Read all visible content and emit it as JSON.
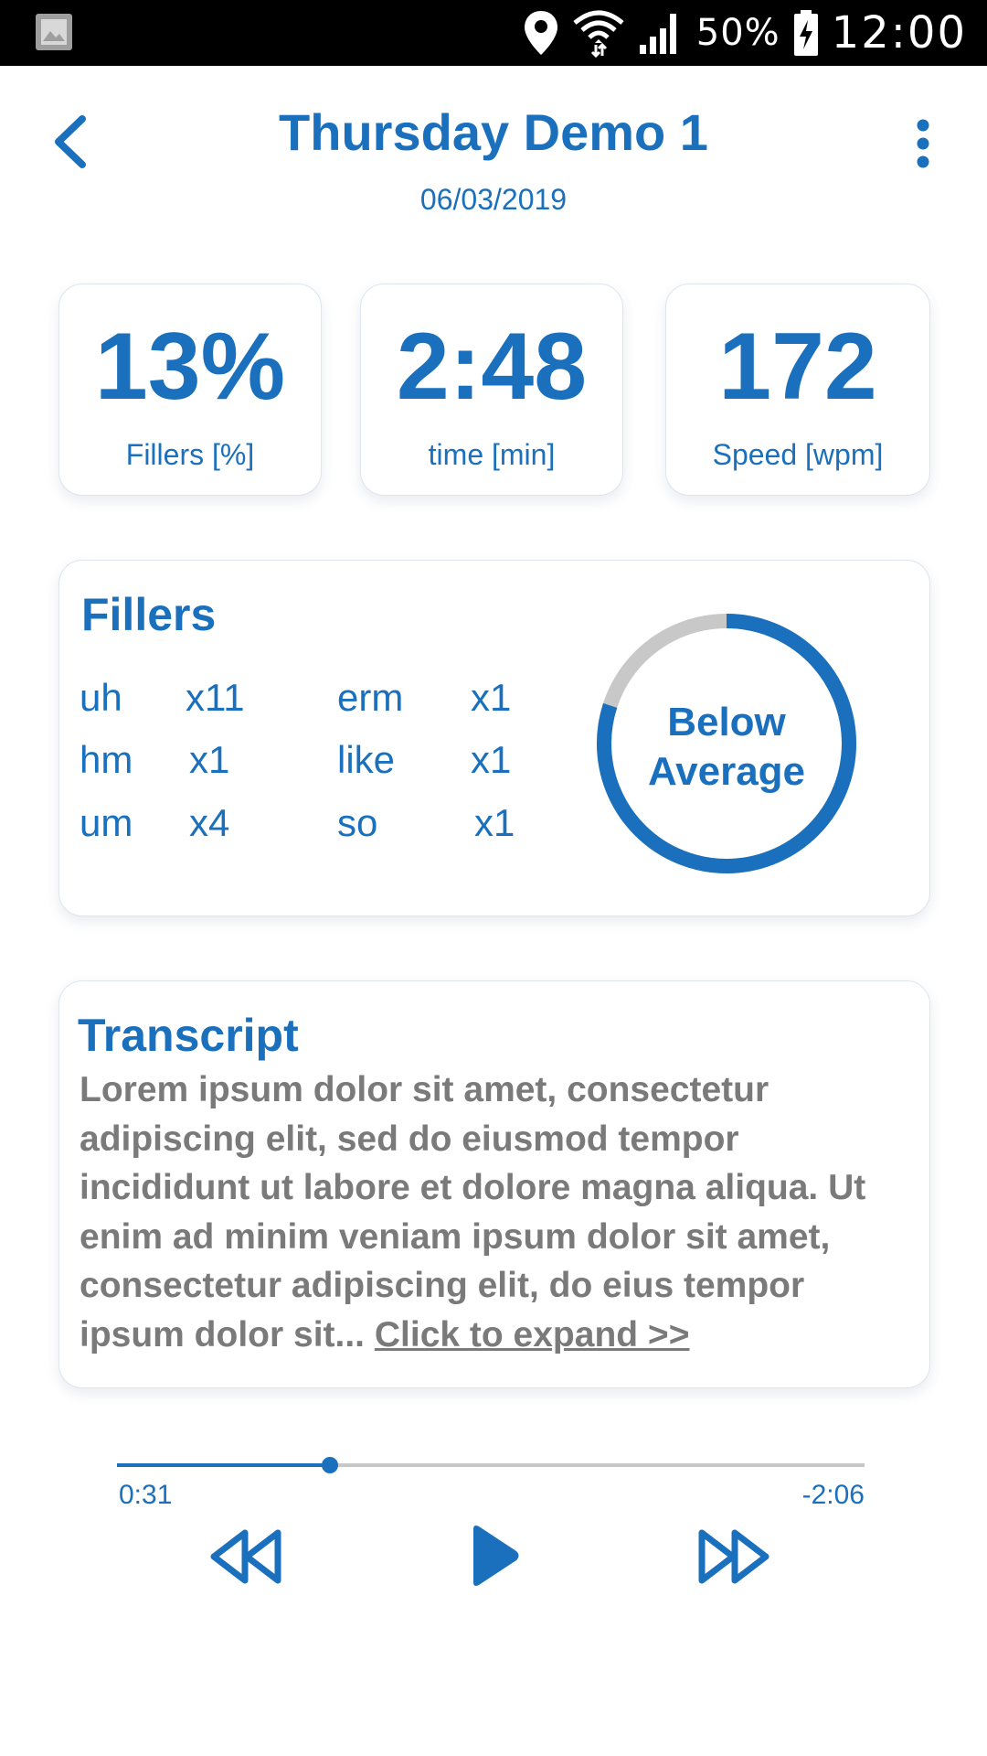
{
  "status_bar": {
    "battery_percent": "50%",
    "time": "12:00",
    "icons": [
      "gallery-icon",
      "location-icon",
      "wifi-icon",
      "signal-icon",
      "battery-charging-icon"
    ]
  },
  "header": {
    "title": "Thursday Demo 1",
    "date": "06/03/2019"
  },
  "stats": [
    {
      "value": "13%",
      "label": "Fillers [%]"
    },
    {
      "value": "2:48",
      "label": "time [min]"
    },
    {
      "value": "172",
      "label": "Speed [wpm]"
    }
  ],
  "fillers": {
    "title": "Fillers",
    "items": [
      {
        "word": "uh",
        "count": "x11"
      },
      {
        "word": "hm",
        "count": "x1"
      },
      {
        "word": "um",
        "count": "x4"
      },
      {
        "word": "erm",
        "count": "x1"
      },
      {
        "word": "like",
        "count": "x1"
      },
      {
        "word": "so",
        "count": "x1"
      }
    ],
    "rating_line1": "Below",
    "rating_line2": "Average",
    "ring_fraction": 0.8
  },
  "transcript": {
    "title": "Transcript",
    "text": "Lorem ipsum dolor sit amet, consectetur adipiscing elit, sed do eiusmod tempor incididunt ut labore et dolore magna aliqua. Ut enim ad minim veniam ipsum dolor sit amet, consectetur adipiscing elit, do eius tempor ipsum dolor sit... ",
    "expand_label": "Click to expand >>"
  },
  "player": {
    "elapsed": "0:31",
    "remaining": "-2:06",
    "progress_fraction": 0.285
  },
  "colors": {
    "accent": "#1a70bd",
    "ring_track": "#c8c8c8",
    "transcript_text": "#7a7a7a"
  }
}
